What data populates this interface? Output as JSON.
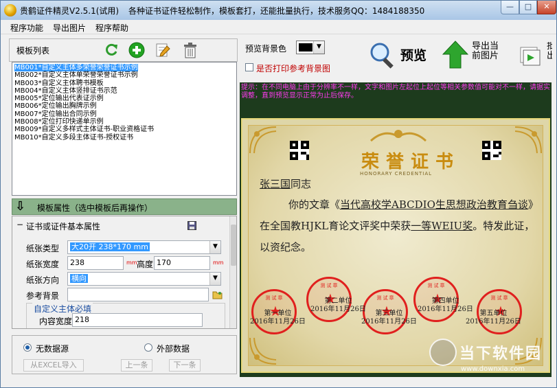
{
  "titlebar": {
    "title": "贵鹤证件精灵V2.5.1(试用)",
    "info": "各种证书证件轻松制作，模板套打，还能批量执行，技术服务QQ：1484188350",
    "min": "—",
    "max": "□",
    "close": "✕"
  },
  "menu": [
    "程序功能",
    "导出图片",
    "程序帮助"
  ],
  "left": {
    "list_title": "模板列表",
    "templates": [
      "MB001*自定义主体多荣誉荣誉证书示例",
      "MB002*自定义主体单荣誉荣誉证书示例",
      "MB003*自定义主体聘书模板",
      "MB004*自定义主体竖排证书示范",
      "MB005*定位输出代表证示例",
      "MB006*定位输出胸牌示例",
      "MB007*定位输出合同示例",
      "MB008*定位打印快递单示例",
      "MB009*自定义多样式主体证书-职业资格证书",
      "MB010*自定义多段主体证书-授权证书"
    ],
    "selected_index": 0,
    "attr_title": "模板属性（选中模板后再操作）",
    "group_title": "证书或证件基本属性",
    "paper_type_label": "纸张类型",
    "paper_type_value": "大20开 238*170 mm",
    "paper_width_label": "纸张宽度",
    "paper_width_value": "238",
    "paper_height_label": "高度",
    "paper_height_value": "170",
    "unit": "mm",
    "orientation_label": "纸张方向",
    "orientation_value": "横向",
    "bg_label": "参考背景",
    "bg_value": "",
    "subgroup_title": "自定义主体必填",
    "content_width_label": "内容宽度",
    "content_width_value": "218",
    "no_datasource": "无数据源",
    "external_data": "外部数据",
    "import_excel": "从EXCEL导入",
    "prev": "上一条",
    "next": "下一条"
  },
  "right": {
    "preview_bg_label": "预览背景色",
    "preview_label": "预览",
    "export_label_1": "导出当",
    "export_label_2": "前图片",
    "batch_label_1": "批",
    "batch_label_2": "出",
    "print_bg_label": "是否打印参考背景图",
    "hint": "提示：在不同电脑上由于分辨率不一样，文字和图片左起位上起位等相关参数值可能对不一样，请据实调整，直到预览显示正常为止后保存。"
  },
  "certificate": {
    "title": "荣誉证书",
    "subtitle": "HONORARY CREDENTIAL",
    "recipient_name": "张三国",
    "recipient_suffix": "同志",
    "line1_a": "你的文章《",
    "article": "当代高校学ABCDIO生思想政治教育刍谈",
    "line1_b": "》在全国教HJKL育论文评奖中荣获",
    "prize": "一等WEIU奖",
    "line1_c": "。特发此证，以资纪念。",
    "seal_text": "测试章",
    "issuers": [
      {
        "name": "第一单位",
        "date": "2016年11月26日"
      },
      {
        "name": "第二单位",
        "date": "2016年11月26日"
      },
      {
        "name": "第三单位",
        "date": "2016年11月26日"
      },
      {
        "name": "第四单位",
        "date": "2016年11月26日"
      },
      {
        "name": "第五单位",
        "date": "2016年11月26日"
      }
    ]
  },
  "watermark": {
    "name": "当下软件园",
    "url": "www.downxia.com"
  },
  "colors": {
    "preview_bg": "#1d3b1d",
    "hint": "#ff3bf0",
    "seal": "#e0201e",
    "title_gold": "#c98c10",
    "unit_red": "#e00000",
    "print_bg_label": "#c00000"
  }
}
